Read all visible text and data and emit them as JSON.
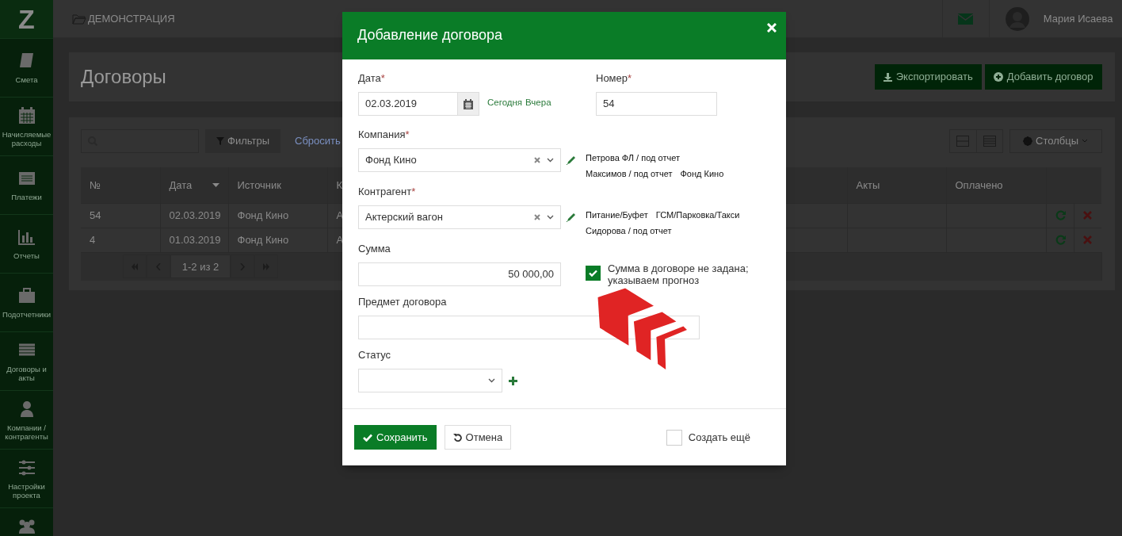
{
  "sidebar": {
    "logo": "Z",
    "items": [
      {
        "label": "Смета"
      },
      {
        "label": "Начисляемые расходы"
      },
      {
        "label": "Платежи"
      },
      {
        "label": "Отчеты"
      },
      {
        "label": "Подотчетники"
      },
      {
        "label": "Договоры и акты"
      },
      {
        "label": "Компании / контрагенты"
      },
      {
        "label": "Настройки проекта"
      },
      {
        "kind": "icon-only"
      }
    ]
  },
  "topbar": {
    "project": "ДЕМОНСТРАЦИЯ",
    "user": "Мария Исаева"
  },
  "page": {
    "title": "Договоры",
    "buttons": [
      {
        "label": "Экспортировать"
      },
      {
        "label": "Добавить договор"
      }
    ]
  },
  "toolbar": {
    "filter_button": "Фильтры",
    "reset_link": "Сбросить",
    "columns_button": "Столбцы"
  },
  "table": {
    "columns": [
      {
        "label": "№",
        "sorted": false
      },
      {
        "label": "Дата",
        "sorted": true
      },
      {
        "label": "Источник",
        "sorted": false
      },
      {
        "label": "К",
        "sorted": false
      },
      {
        "label": "Акты",
        "sorted": false
      },
      {
        "label": "Оплачено",
        "sorted": false
      }
    ],
    "rows": [
      {
        "cells": [
          "54",
          "02.03.2019",
          "Фонд Кино",
          "А"
        ]
      },
      {
        "cells": [
          "4",
          "01.03.2019",
          "Фонд Кино",
          "А"
        ]
      }
    ],
    "pagination": "1-2 из 2"
  },
  "modal": {
    "title": "Добавление договора",
    "date": {
      "label": "Дата",
      "required_mark": "*",
      "value": "02.03.2019",
      "shortcuts": [
        "Сегодня",
        "Вчера"
      ]
    },
    "number": {
      "label": "Номер",
      "required_mark": "*",
      "value": "54"
    },
    "company": {
      "label": "Компания",
      "required_mark": "*",
      "value": "Фонд Кино",
      "suggestions": [
        "Петрова ФЛ / под отчет",
        "Максимов / под отчет",
        "Фонд Кино"
      ]
    },
    "counterparty": {
      "label": "Контрагент",
      "required_mark": "*",
      "value": "Актерский вагон",
      "suggestions": [
        "Питание/Буфет",
        "ГСМ/Парковка/Такси",
        "Сидорова / под отчет"
      ]
    },
    "amount": {
      "label": "Сумма",
      "value": "50 000,00",
      "forecast": {
        "label": "Сумма в договоре не задана; указываем прогноз",
        "checked": true
      }
    },
    "subject": {
      "label": "Предмет договора"
    },
    "status": {
      "label": "Статус"
    },
    "save_button": "Сохранить",
    "cancel_button": "Отмена",
    "create_more": {
      "label": "Создать ещё",
      "checked": false
    }
  },
  "annotation": {
    "kind": "chevron-arrow"
  }
}
